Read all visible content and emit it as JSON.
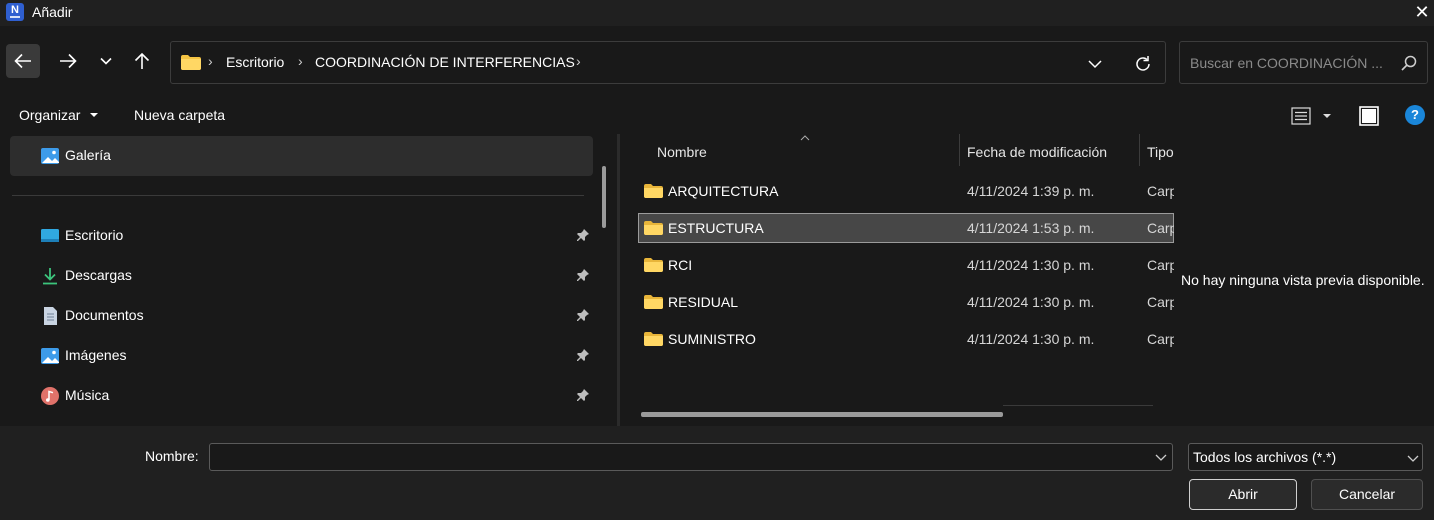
{
  "window": {
    "title": "Añadir",
    "app_icon": "N",
    "close_glyph": "✕"
  },
  "navigation": {
    "breadcrumb": [
      "Escritorio",
      "COORDINACIÓN DE INTERFERENCIAS"
    ],
    "separator": "›",
    "search_placeholder": "Buscar en COORDINACIÓN ..."
  },
  "commands": {
    "organize_label": "Organizar",
    "new_folder_label": "Nueva carpeta",
    "help_glyph": "?"
  },
  "sidebar": {
    "gallery_label": "Galería",
    "items": [
      {
        "label": "Escritorio",
        "icon": "desktop-icon",
        "pinned": true
      },
      {
        "label": "Descargas",
        "icon": "downloads-icon",
        "pinned": true
      },
      {
        "label": "Documentos",
        "icon": "documents-icon",
        "pinned": true
      },
      {
        "label": "Imágenes",
        "icon": "pictures-icon",
        "pinned": true
      },
      {
        "label": "Música",
        "icon": "music-icon",
        "pinned": true
      }
    ]
  },
  "file_list": {
    "columns": [
      "Nombre",
      "Fecha de modificación",
      "Tipo"
    ],
    "rows": [
      {
        "name": "ARQUITECTURA",
        "modified": "4/11/2024 1:39 p. m.",
        "type": "Carp",
        "selected": false
      },
      {
        "name": "ESTRUCTURA",
        "modified": "4/11/2024 1:53 p. m.",
        "type": "Carp",
        "selected": true
      },
      {
        "name": "RCI",
        "modified": "4/11/2024 1:30 p. m.",
        "type": "Carp",
        "selected": false
      },
      {
        "name": "RESIDUAL",
        "modified": "4/11/2024 1:30 p. m.",
        "type": "Carp",
        "selected": false
      },
      {
        "name": "SUMINISTRO",
        "modified": "4/11/2024 1:30 p. m.",
        "type": "Carp",
        "selected": false
      }
    ]
  },
  "preview": {
    "message": "No hay ninguna vista previa disponible."
  },
  "footer": {
    "filename_label": "Nombre:",
    "filename_value": "",
    "filter_value": "Todos los archivos (*.*)",
    "open_label": "Abrir",
    "cancel_label": "Cancelar"
  },
  "colors": {
    "background": "#191919",
    "titlebar": "#202020",
    "selection": "#474747",
    "folder": "#f5c443",
    "accent": "#1a86d9"
  }
}
